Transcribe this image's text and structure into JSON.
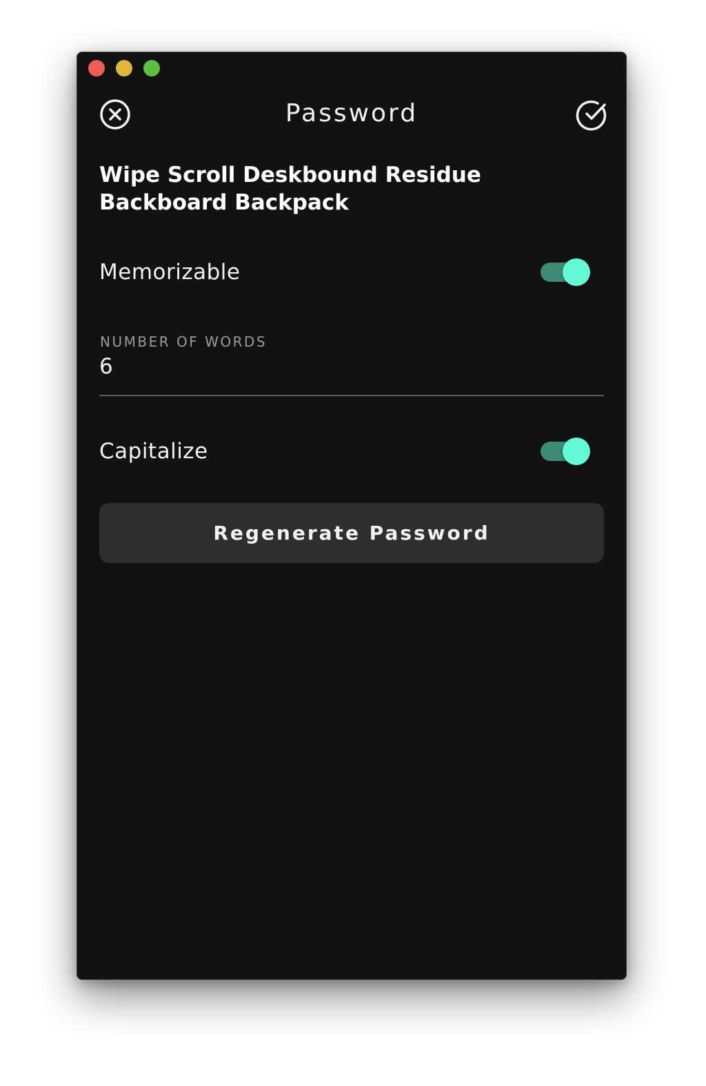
{
  "window": {
    "controls": [
      "close",
      "minimize",
      "zoom"
    ]
  },
  "header": {
    "title": "Password",
    "left_icon": "close-circle-icon",
    "right_icon": "check-circle-icon"
  },
  "password": {
    "generated": "Wipe Scroll Deskbound Residue Backboard Backpack"
  },
  "options": {
    "memorizable": {
      "label": "Memorizable",
      "on": true
    },
    "number_of_words": {
      "label": "NUMBER OF WORDS",
      "value": "6"
    },
    "capitalize": {
      "label": "Capitalize",
      "on": true
    }
  },
  "actions": {
    "regenerate_label": "Regenerate Password"
  },
  "colors": {
    "background": "#121212",
    "toggle_knob": "#64fad7",
    "toggle_track": "#3e8a76",
    "button_bg": "#2e2e2e"
  }
}
